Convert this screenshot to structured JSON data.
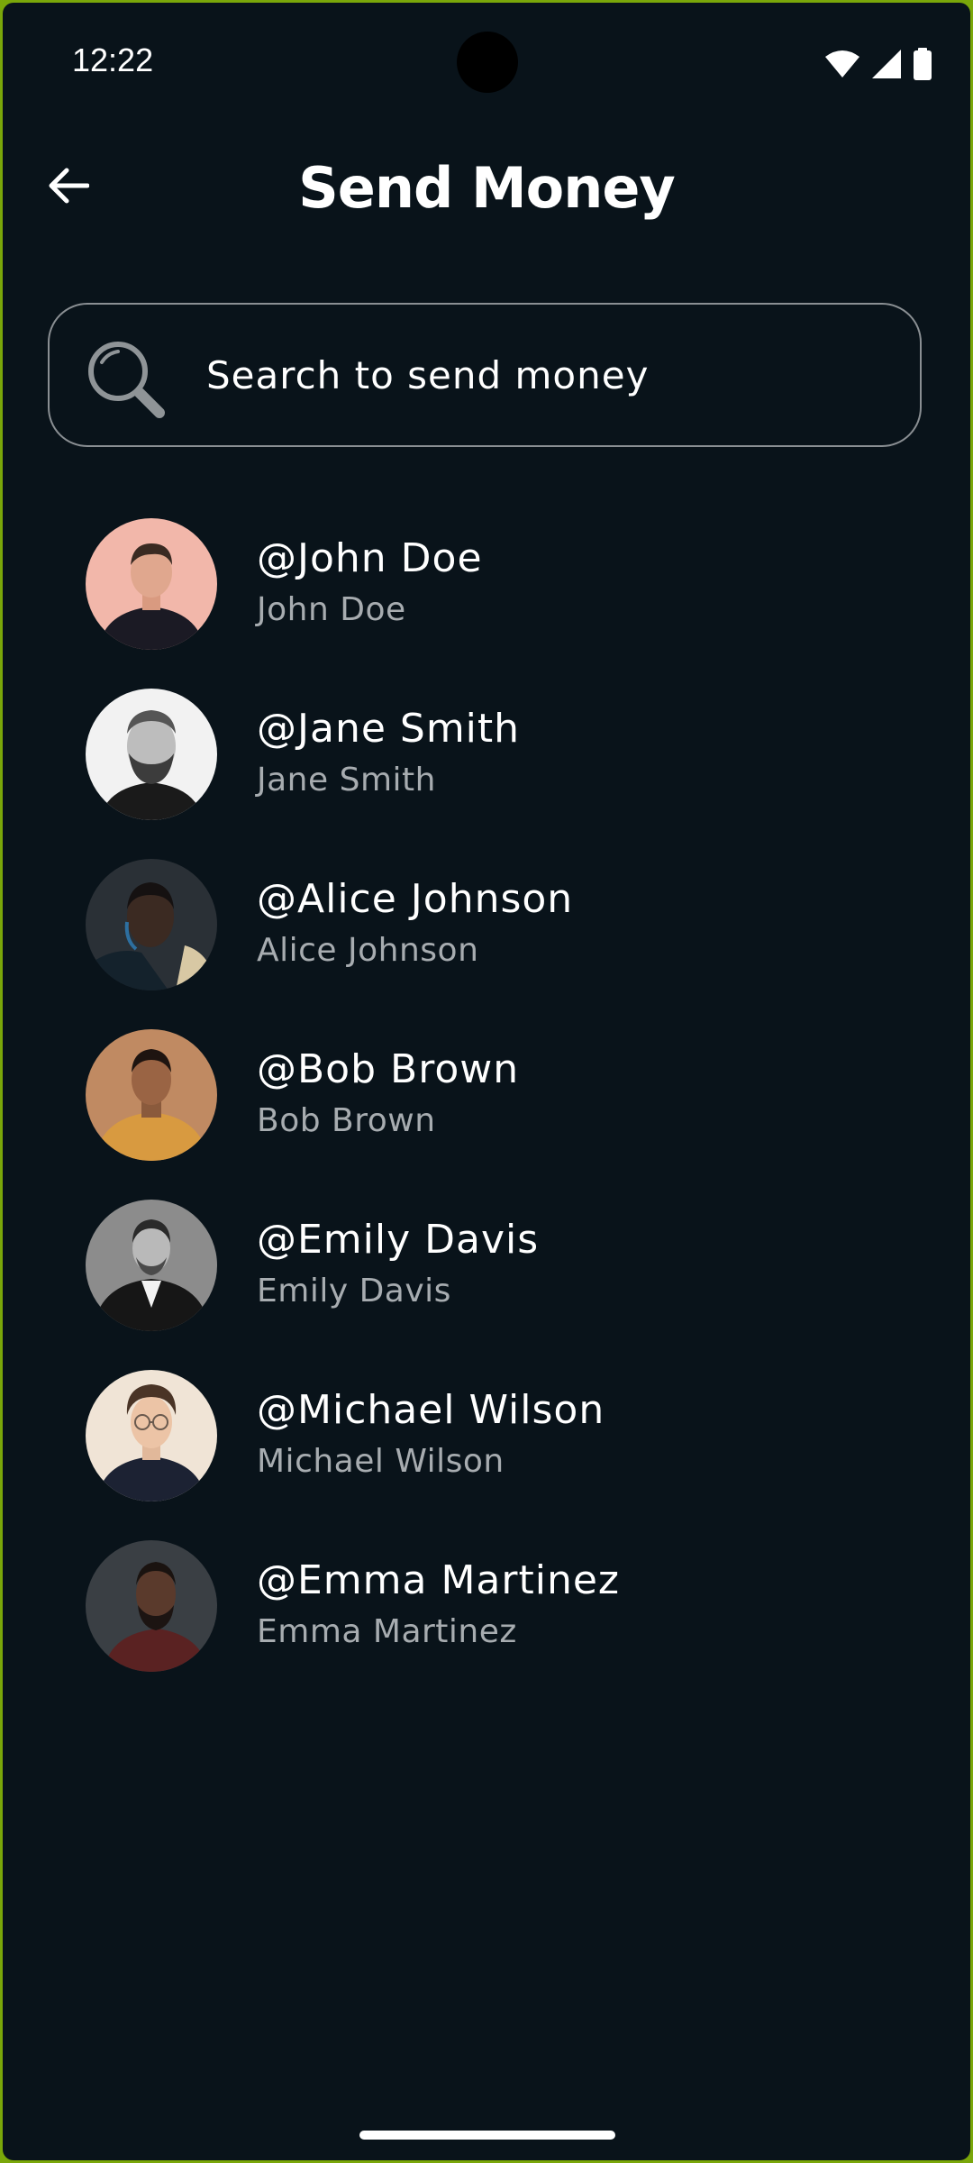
{
  "status_bar": {
    "time": "12:22",
    "icons": [
      "wifi-icon",
      "signal-icon",
      "battery-icon"
    ]
  },
  "header": {
    "title": "Send Money",
    "back_icon": "arrow-left-icon"
  },
  "search": {
    "placeholder": "Search to send money",
    "value": "",
    "icon": "search-icon"
  },
  "contacts": [
    {
      "handle": "@John Doe",
      "name": "John Doe"
    },
    {
      "handle": "@Jane Smith",
      "name": "Jane Smith"
    },
    {
      "handle": "@Alice Johnson",
      "name": "Alice Johnson"
    },
    {
      "handle": "@Bob Brown",
      "name": "Bob Brown"
    },
    {
      "handle": "@Emily Davis",
      "name": "Emily Davis"
    },
    {
      "handle": "@Michael Wilson",
      "name": "Michael Wilson"
    },
    {
      "handle": "@Emma Martinez",
      "name": "Emma Martinez"
    }
  ],
  "colors": {
    "background": "#09131a",
    "frame": "#7aa70a",
    "text_primary": "#ffffff",
    "text_secondary": "#a7acb0",
    "search_border": "#8a8f93"
  }
}
